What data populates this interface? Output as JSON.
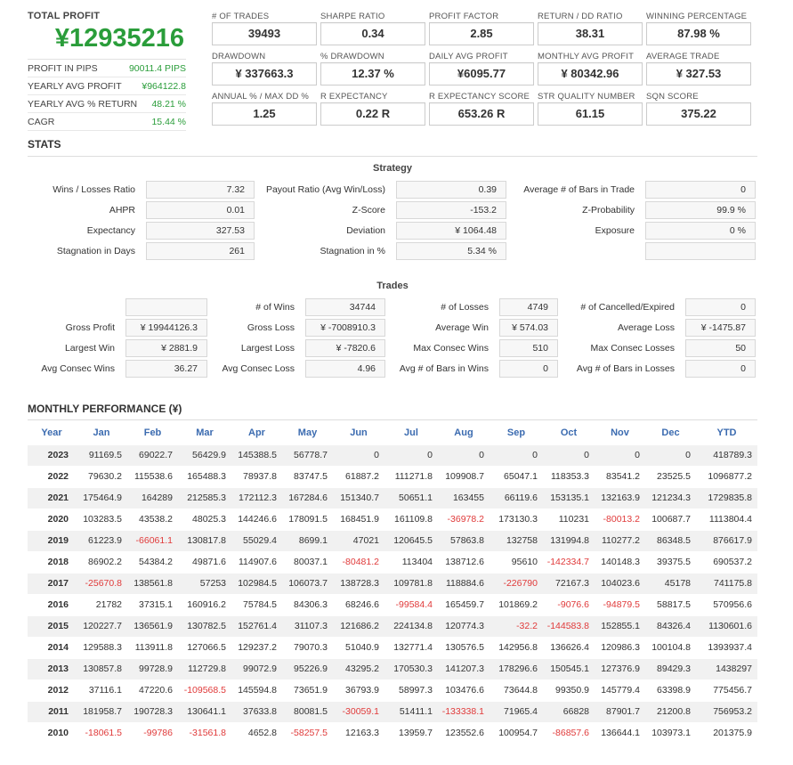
{
  "summary": {
    "total_label": "TOTAL PROFIT",
    "total_value": "¥12935216",
    "rows": [
      {
        "label": "PROFIT IN PIPS",
        "value": "90011.4 PIPS"
      },
      {
        "label": "YEARLY AVG PROFIT",
        "value": "¥964122.8"
      },
      {
        "label": "YEARLY AVG % RETURN",
        "value": "48.21 %"
      },
      {
        "label": "CAGR",
        "value": "15.44 %"
      }
    ]
  },
  "metrics": [
    {
      "label": "# OF TRADES",
      "value": "39493"
    },
    {
      "label": "SHARPE RATIO",
      "value": "0.34"
    },
    {
      "label": "PROFIT FACTOR",
      "value": "2.85"
    },
    {
      "label": "RETURN / DD RATIO",
      "value": "38.31"
    },
    {
      "label": "WINNING PERCENTAGE",
      "value": "87.98 %"
    },
    {
      "label": "DRAWDOWN",
      "value": "¥ 337663.3"
    },
    {
      "label": "% DRAWDOWN",
      "value": "12.37 %"
    },
    {
      "label": "DAILY AVG PROFIT",
      "value": "¥6095.77"
    },
    {
      "label": "MONTHLY AVG PROFIT",
      "value": "¥ 80342.96"
    },
    {
      "label": "AVERAGE TRADE",
      "value": "¥ 327.53"
    },
    {
      "label": "ANNUAL % / MAX DD %",
      "value": "1.25"
    },
    {
      "label": "R EXPECTANCY",
      "value": "0.22 R"
    },
    {
      "label": "R EXPECTANCY SCORE",
      "value": "653.26 R"
    },
    {
      "label": "STR QUALITY NUMBER",
      "value": "61.15"
    },
    {
      "label": "SQN SCORE",
      "value": "375.22"
    }
  ],
  "stats": {
    "title": "STATS",
    "strategy_title": "Strategy",
    "strategy": [
      [
        {
          "label": "Wins / Losses Ratio",
          "value": "7.32"
        },
        {
          "label": "Payout Ratio (Avg Win/Loss)",
          "value": "0.39"
        },
        {
          "label": "Average # of Bars in Trade",
          "value": "0"
        }
      ],
      [
        {
          "label": "AHPR",
          "value": "0.01"
        },
        {
          "label": "Z-Score",
          "value": "-153.2"
        },
        {
          "label": "Z-Probability",
          "value": "99.9 %"
        }
      ],
      [
        {
          "label": "Expectancy",
          "value": "327.53"
        },
        {
          "label": "Deviation",
          "value": "¥ 1064.48"
        },
        {
          "label": "Exposure",
          "value": "0 %"
        }
      ],
      [
        {
          "label": "Stagnation in Days",
          "value": "261"
        },
        {
          "label": "Stagnation in %",
          "value": "5.34 %"
        },
        {
          "label": "",
          "value": ""
        }
      ]
    ],
    "trades_title": "Trades",
    "trades": [
      [
        {
          "label": "",
          "value": ""
        },
        {
          "label": "# of Wins",
          "value": "34744"
        },
        {
          "label": "# of Losses",
          "value": "4749"
        },
        {
          "label": "# of Cancelled/Expired",
          "value": "0"
        }
      ],
      [
        {
          "label": "Gross Profit",
          "value": "¥ 19944126.3"
        },
        {
          "label": "Gross Loss",
          "value": "¥ -7008910.3"
        },
        {
          "label": "Average Win",
          "value": "¥ 574.03"
        },
        {
          "label": "Average Loss",
          "value": "¥ -1475.87"
        }
      ],
      [
        {
          "label": "Largest Win",
          "value": "¥ 2881.9"
        },
        {
          "label": "Largest Loss",
          "value": "¥ -7820.6"
        },
        {
          "label": "Max Consec Wins",
          "value": "510"
        },
        {
          "label": "Max Consec Losses",
          "value": "50"
        }
      ],
      [
        {
          "label": "Avg Consec Wins",
          "value": "36.27"
        },
        {
          "label": "Avg Consec Loss",
          "value": "4.96"
        },
        {
          "label": "Avg # of Bars in Wins",
          "value": "0"
        },
        {
          "label": "Avg # of Bars in Losses",
          "value": "0"
        }
      ]
    ]
  },
  "monthly": {
    "title": "MONTHLY PERFORMANCE (¥)",
    "headers": [
      "Year",
      "Jan",
      "Feb",
      "Mar",
      "Apr",
      "May",
      "Jun",
      "Jul",
      "Aug",
      "Sep",
      "Oct",
      "Nov",
      "Dec",
      "YTD"
    ],
    "rows": [
      [
        "2023",
        "91169.5",
        "69022.7",
        "56429.9",
        "145388.5",
        "56778.7",
        "0",
        "0",
        "0",
        "0",
        "0",
        "0",
        "0",
        "418789.3"
      ],
      [
        "2022",
        "79630.2",
        "115538.6",
        "165488.3",
        "78937.8",
        "83747.5",
        "61887.2",
        "111271.8",
        "109908.7",
        "65047.1",
        "118353.3",
        "83541.2",
        "23525.5",
        "1096877.2"
      ],
      [
        "2021",
        "175464.9",
        "164289",
        "212585.3",
        "172112.3",
        "167284.6",
        "151340.7",
        "50651.1",
        "163455",
        "66119.6",
        "153135.1",
        "132163.9",
        "121234.3",
        "1729835.8"
      ],
      [
        "2020",
        "103283.5",
        "43538.2",
        "48025.3",
        "144246.6",
        "178091.5",
        "168451.9",
        "161109.8",
        "-36978.2",
        "173130.3",
        "110231",
        "-80013.2",
        "100687.7",
        "1113804.4"
      ],
      [
        "2019",
        "61223.9",
        "-66061.1",
        "130817.8",
        "55029.4",
        "8699.1",
        "47021",
        "120645.5",
        "57863.8",
        "132758",
        "131994.8",
        "110277.2",
        "86348.5",
        "876617.9"
      ],
      [
        "2018",
        "86902.2",
        "54384.2",
        "49871.6",
        "114907.6",
        "80037.1",
        "-80481.2",
        "113404",
        "138712.6",
        "95610",
        "-142334.7",
        "140148.3",
        "39375.5",
        "690537.2"
      ],
      [
        "2017",
        "-25670.8",
        "138561.8",
        "57253",
        "102984.5",
        "106073.7",
        "138728.3",
        "109781.8",
        "118884.6",
        "-226790",
        "72167.3",
        "104023.6",
        "45178",
        "741175.8"
      ],
      [
        "2016",
        "21782",
        "37315.1",
        "160916.2",
        "75784.5",
        "84306.3",
        "68246.6",
        "-99584.4",
        "165459.7",
        "101869.2",
        "-9076.6",
        "-94879.5",
        "58817.5",
        "570956.6"
      ],
      [
        "2015",
        "120227.7",
        "136561.9",
        "130782.5",
        "152761.4",
        "31107.3",
        "121686.2",
        "224134.8",
        "120774.3",
        "-32.2",
        "-144583.8",
        "152855.1",
        "84326.4",
        "1130601.6"
      ],
      [
        "2014",
        "129588.3",
        "113911.8",
        "127066.5",
        "129237.2",
        "79070.3",
        "51040.9",
        "132771.4",
        "130576.5",
        "142956.8",
        "136626.4",
        "120986.3",
        "100104.8",
        "1393937.4"
      ],
      [
        "2013",
        "130857.8",
        "99728.9",
        "112729.8",
        "99072.9",
        "95226.9",
        "43295.2",
        "170530.3",
        "141207.3",
        "178296.6",
        "150545.1",
        "127376.9",
        "89429.3",
        "1438297"
      ],
      [
        "2012",
        "37116.1",
        "47220.6",
        "-109568.5",
        "145594.8",
        "73651.9",
        "36793.9",
        "58997.3",
        "103476.6",
        "73644.8",
        "99350.9",
        "145779.4",
        "63398.9",
        "775456.7"
      ],
      [
        "2011",
        "181958.7",
        "190728.3",
        "130641.1",
        "37633.8",
        "80081.5",
        "-30059.1",
        "51411.1",
        "-133338.1",
        "71965.4",
        "66828",
        "87901.7",
        "21200.8",
        "756953.2"
      ],
      [
        "2010",
        "-18061.5",
        "-99786",
        "-31561.8",
        "4652.8",
        "-58257.5",
        "12163.3",
        "13959.7",
        "123552.6",
        "100954.7",
        "-86857.6",
        "136644.1",
        "103973.1",
        "201375.9"
      ]
    ]
  },
  "colors": {
    "profit_green": "#2a9d3a",
    "loss_red": "#e03a3a",
    "header_blue": "#3b6bb0"
  }
}
